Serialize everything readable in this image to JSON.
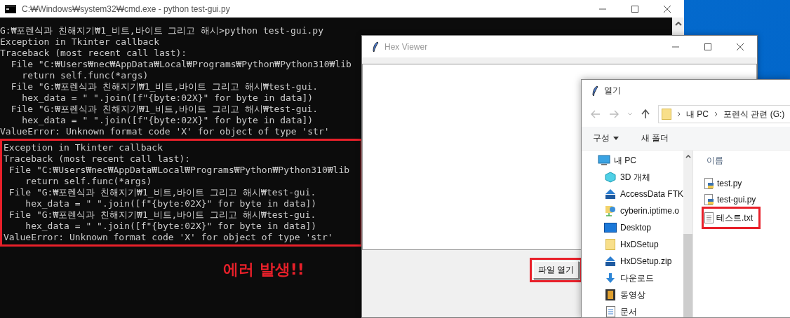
{
  "console_window": {
    "title": "C:₩Windows₩system32₩cmd.exe - python  test-gui.py",
    "lines": [
      "G:₩포렌식과 친해지기₩1_비트,바이트 그리고 해시>python test-gui.py",
      "Exception in Tkinter callback",
      "Traceback (most recent call last):",
      "  File \"C:₩Users₩nec₩AppData₩Local₩Programs₩Python₩Python310₩lib",
      "    return self.func(*args)",
      "  File \"G:₩포렌식과 친해지기₩1_비트,바이트 그리고 해시₩test-gui.",
      "    hex_data = \" \".join([f\"{byte:02X}\" for byte in data])",
      "  File \"G:₩포렌식과 친해지기₩1_비트,바이트 그리고 해시₩test-gui.",
      "    hex_data = \" \".join([f\"{byte:02X}\" for byte in data])",
      "ValueError: Unknown format code 'X' for object of type 'str'"
    ],
    "boxed_lines": [
      "Exception in Tkinter callback",
      "Traceback (most recent call last):",
      " File \"C:₩Users₩nec₩AppData₩Local₩Programs₩Python₩Python310₩lib",
      "    return self.func(*args)",
      " File \"G:₩포렌식과 친해지기₩1_비트,바이트 그리고 해시₩test-gui.",
      "    hex_data = \" \".join([f\"{byte:02X}\" for byte in data])",
      " File \"G:₩포렌식과 친해지기₩1_비트,바이트 그리고 해시₩test-gui.",
      "    hex_data = \" \".join([f\"{byte:02X}\" for byte in data])",
      "ValueError: Unknown format code 'X' for object of type 'str'"
    ],
    "note": "에러 발생!!"
  },
  "hex_viewer": {
    "title": "Hex Viewer",
    "button": {
      "label": "파일 열기",
      "highlighted": true
    }
  },
  "open_dialog": {
    "title": "열기",
    "breadcrumb": [
      "내 PC",
      "포렌식 관련 (G:)"
    ],
    "toolbar": [
      {
        "label": "구성",
        "dropdown": true
      },
      {
        "label": "새 폴더",
        "dropdown": false
      }
    ],
    "nav_items": [
      {
        "label": "내 PC",
        "kind": "pc",
        "children": [
          {
            "label": "3D 개체",
            "kind": "cube"
          },
          {
            "label": "AccessData FTK",
            "kind": "zip"
          },
          {
            "label": "cyberin.iptime.o",
            "kind": "network"
          },
          {
            "label": "Desktop",
            "kind": "desktop"
          },
          {
            "label": "HxDSetup",
            "kind": "folder"
          },
          {
            "label": "HxDSetup.zip",
            "kind": "zip"
          },
          {
            "label": "다운로드",
            "kind": "download"
          },
          {
            "label": "동영상",
            "kind": "video"
          },
          {
            "label": "문서",
            "kind": "document"
          }
        ]
      }
    ],
    "column_header": "이름",
    "files": [
      {
        "name": "test.py",
        "kind": "python",
        "highlighted": false
      },
      {
        "name": "test-gui.py",
        "kind": "python",
        "highlighted": false
      },
      {
        "name": "테스트.txt",
        "kind": "text",
        "highlighted": true
      }
    ]
  }
}
